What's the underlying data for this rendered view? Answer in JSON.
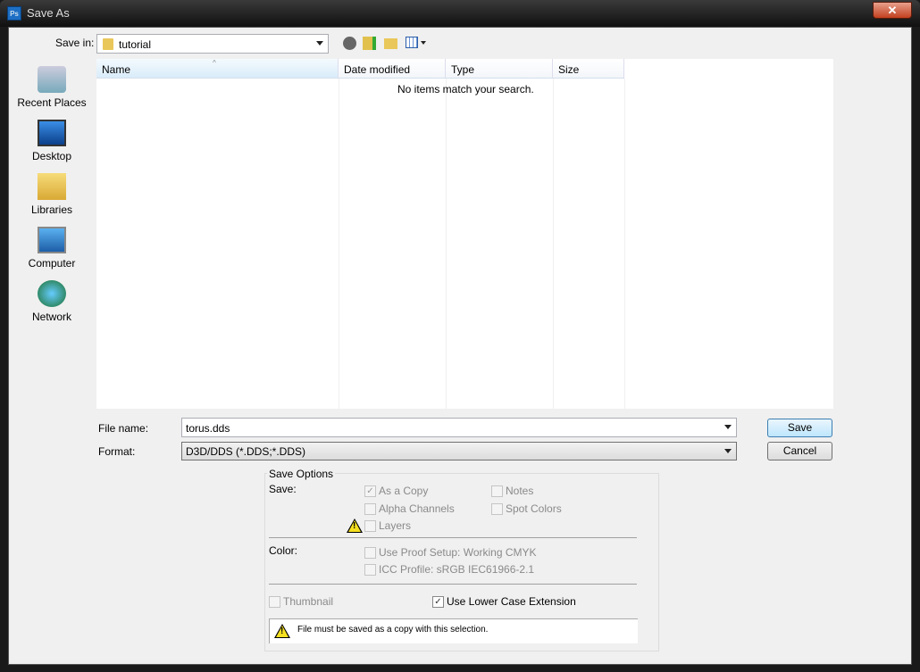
{
  "window": {
    "title": "Save As",
    "icon_text": "Ps",
    "close": "✕"
  },
  "save_in": {
    "label": "Save in:",
    "value": "tutorial"
  },
  "sidebar": {
    "items": [
      {
        "label": "Recent Places"
      },
      {
        "label": "Desktop"
      },
      {
        "label": "Libraries"
      },
      {
        "label": "Computer"
      },
      {
        "label": "Network"
      }
    ]
  },
  "list": {
    "columns": [
      "Name",
      "Date modified",
      "Type",
      "Size"
    ],
    "empty_message": "No items match your search."
  },
  "file_name": {
    "label": "File name:",
    "value": "torus.dds"
  },
  "format": {
    "label": "Format:",
    "value": "D3D/DDS (*.DDS;*.DDS)"
  },
  "buttons": {
    "save": "Save",
    "cancel": "Cancel"
  },
  "options": {
    "title": "Save Options",
    "save_label": "Save:",
    "as_copy": "As a Copy",
    "notes": "Notes",
    "alpha": "Alpha Channels",
    "spot": "Spot Colors",
    "layers": "Layers",
    "color_label": "Color:",
    "proof": "Use Proof Setup:  Working CMYK",
    "icc": "ICC Profile:  sRGB IEC61966-2.1",
    "thumbnail": "Thumbnail",
    "lowercase": "Use Lower Case Extension",
    "warning": "File must be saved as a copy with this selection.",
    "check": "✓"
  }
}
